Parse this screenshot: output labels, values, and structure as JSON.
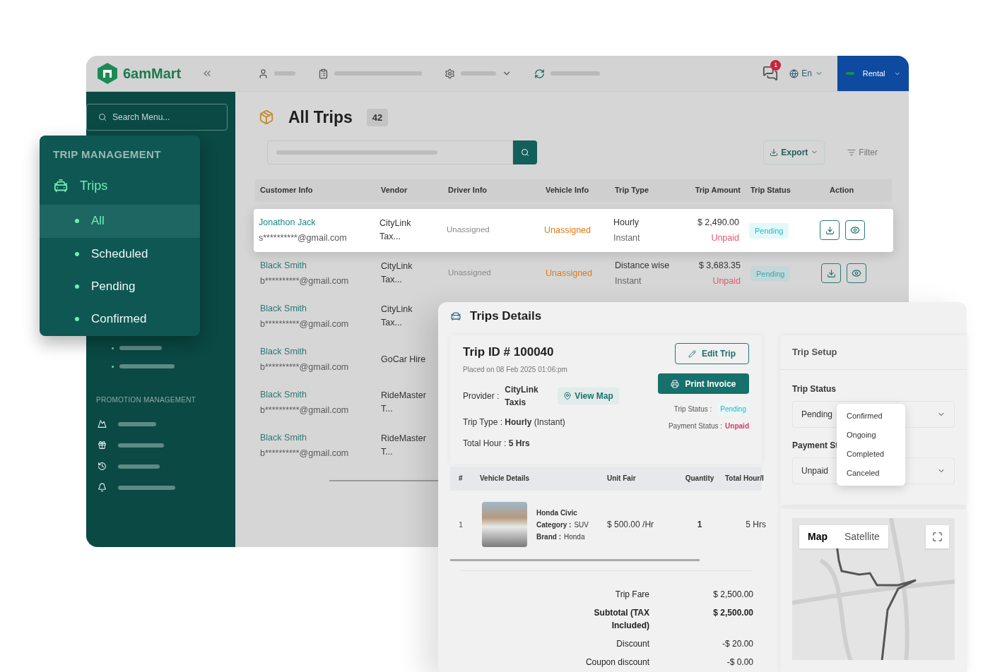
{
  "topbar": {
    "logo": "6amMart",
    "notification_count": "1",
    "language": "En",
    "module": "Rental"
  },
  "sidebar": {
    "search_placeholder": "Search Menu...",
    "section": "PROMOTION MANAGEMENT"
  },
  "trip_menu": {
    "heading": "TRIP MANAGEMENT",
    "title": "Trips",
    "items": [
      {
        "label": "All",
        "selected": true
      },
      {
        "label": "Scheduled",
        "selected": false
      },
      {
        "label": "Pending",
        "selected": false
      },
      {
        "label": "Confirmed",
        "selected": false
      }
    ]
  },
  "page": {
    "title": "All Trips",
    "count": "42",
    "export": "Export",
    "filter": "Filter"
  },
  "table": {
    "columns": [
      "Customer Info",
      "Vendor",
      "Driver Info",
      "Vehicle Info",
      "Trip Type",
      "Trip Amount",
      "Trip Status",
      "Action"
    ],
    "rows": [
      {
        "selected": true,
        "customer": "Jonathon Jack",
        "email": "s**********@gmail.com",
        "vendor": "CityLink Tax...",
        "driver": "Unassigned",
        "vehicle": "Unassigned",
        "trip_type": "Hourly",
        "trip_mode": "Instant",
        "amount": "$ 2,490.00",
        "payment": "Unpaid",
        "status": "Pending"
      },
      {
        "selected": false,
        "customer": "Black Smith",
        "email": "b**********@gmail.com",
        "vendor": "CityLink Tax...",
        "driver": "Unassigned",
        "vehicle": "Unassigned",
        "trip_type": "Distance wise",
        "trip_mode": "Instant",
        "amount": "$ 3,683.35",
        "payment": "Unpaid",
        "status": "Pending"
      },
      {
        "selected": false,
        "customer": "Black Smith",
        "email": "b**********@gmail.com",
        "vendor": "CityLink Tax..."
      },
      {
        "selected": false,
        "customer": "Black Smith",
        "email": "b**********@gmail.com",
        "vendor": "GoCar Hire"
      },
      {
        "selected": false,
        "customer": "Black Smith",
        "email": "b**********@gmail.com",
        "vendor": "RideMaster T..."
      },
      {
        "selected": false,
        "customer": "Black Smith",
        "email": "b**********@gmail.com",
        "vendor": "RideMaster T..."
      }
    ]
  },
  "details": {
    "title": "Trips Details",
    "trip_id": "Trip ID # 100040",
    "placed": "Placed on 08 Feb 2025 01:06:pm",
    "provider_label": "Provider :",
    "provider": "CityLink Taxis",
    "view_map": "View Map",
    "edit": "Edit Trip",
    "print": "Print Invoice",
    "trip_type": "Trip Type : **Hourly** (Instant)",
    "total_hour": "Total Hour : **5 Hrs**",
    "status_label": "Trip Status :",
    "status": "Pending",
    "payment_label": "Payment Status :",
    "payment": "Unpaid",
    "item_columns": [
      "#",
      "Vehicle Details",
      "Unit Fair",
      "Quantity",
      "Total Hour/I"
    ],
    "items": [
      {
        "index": "1",
        "name": "Honda Civic",
        "category_label": "Category :",
        "category": "SUV",
        "brand_label": "Brand :",
        "brand": "Honda",
        "unit": "$ 500.00 /Hr",
        "quantity": "1",
        "total": "5 Hrs"
      }
    ],
    "summary": [
      {
        "label": "Trip Fare",
        "value": "$ 2,500.00",
        "bold": false
      },
      {
        "label": "Subtotal (TAX Included)",
        "value": "$ 2,500.00",
        "bold": true
      },
      {
        "label": "Discount",
        "value": "-$ 20.00",
        "bold": false
      },
      {
        "label": "Coupon discount",
        "value": "-$ 0.00",
        "bold": false
      }
    ]
  },
  "setup": {
    "title": "Trip Setup",
    "status_label": "Trip Status",
    "status_value": "Pending",
    "payment_label": "Payment St",
    "payment_value": "Unpaid",
    "options": [
      "Confirmed",
      "Ongoing",
      "Completed",
      "Canceled"
    ]
  },
  "map": {
    "tabs": [
      {
        "label": "Map",
        "selected": true
      },
      {
        "label": "Satellite",
        "selected": false
      }
    ]
  }
}
